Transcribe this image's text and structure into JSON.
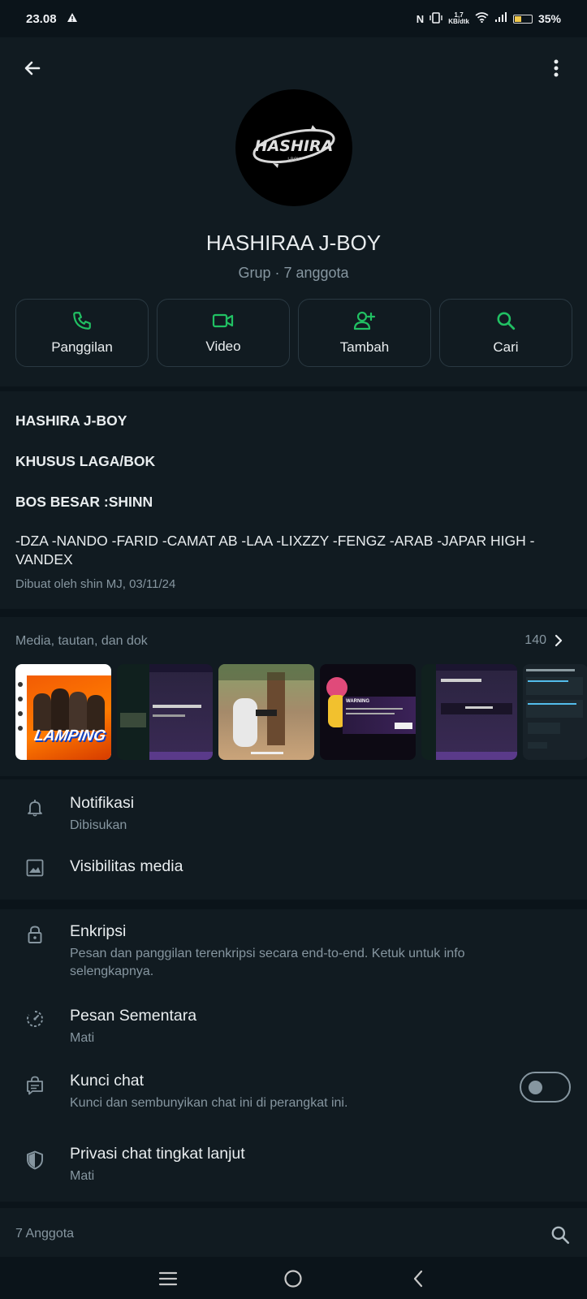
{
  "status_bar": {
    "time": "23.08",
    "speed_top": "1,7",
    "speed_bottom": "KB/dtk",
    "battery": "35%",
    "battery_level": 0.35
  },
  "header": {
    "group_name": "HASHIRAA J-BOY",
    "subtitle": "Grup · 7 anggota",
    "avatar_text": "HASHIRA",
    "avatar_subtext": "J-BOY"
  },
  "actions": [
    {
      "label": "Panggilan",
      "icon": "phone-icon"
    },
    {
      "label": "Video",
      "icon": "video-icon"
    },
    {
      "label": "Tambah",
      "icon": "add-person-icon"
    },
    {
      "label": "Cari",
      "icon": "search-icon"
    }
  ],
  "description": {
    "line1": "HASHIRA J-BOY",
    "line2": "KHUSUS LAGA/BOK",
    "line3": "BOS BESAR :SHINN",
    "members": "-DZA  -NANDO  -FARID   -CAMAT AB  -LAA -LIXZZY  -FENGZ -ARAB  -JAPAR HIGH -VANDEX",
    "created": "Dibuat oleh shin MJ, 03/11/24"
  },
  "media": {
    "title": "Media, tautan, dan dok",
    "count": "140",
    "thumb_overlay": "LAMPING",
    "warning_title": "WARNING"
  },
  "settings": {
    "notifications": {
      "label": "Notifikasi",
      "value": "Dibisukan"
    },
    "media_visibility": {
      "label": "Visibilitas media"
    },
    "encryption": {
      "label": "Enkripsi",
      "value": "Pesan dan panggilan terenkripsi secara end-to-end. Ketuk untuk info selengkapnya."
    },
    "disappearing": {
      "label": "Pesan Sementara",
      "value": "Mati"
    },
    "chat_lock": {
      "label": "Kunci chat",
      "value": "Kunci dan sembunyikan chat ini di perangkat ini.",
      "enabled": false
    },
    "advanced_privacy": {
      "label": "Privasi chat tingkat lanjut",
      "value": "Mati"
    }
  },
  "members_section": {
    "label": "7 Anggota"
  },
  "colors": {
    "accent": "#21c063",
    "background": "#0b141a",
    "panel": "#111b21",
    "secondary_text": "#8696a0"
  }
}
